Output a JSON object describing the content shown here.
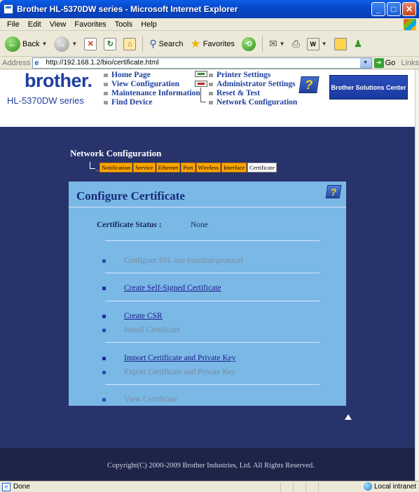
{
  "window": {
    "title": "Brother HL-5370DW series - Microsoft Internet Explorer"
  },
  "menu": [
    "File",
    "Edit",
    "View",
    "Favorites",
    "Tools",
    "Help"
  ],
  "toolbar": {
    "back": "Back",
    "search": "Search",
    "favorites": "Favorites"
  },
  "address": {
    "label": "Address",
    "url": "http://192.168.1.2/bio/certificate.html",
    "go": "Go",
    "links": "Links"
  },
  "header": {
    "logo": "brother.",
    "model": "HL-5370DW series",
    "nav_left": [
      "Home Page",
      "View Configuration",
      "Maintenance Information",
      "Find Device"
    ],
    "nav_right": [
      "Printer Settings",
      "Administrator Settings",
      "Reset & Test",
      "Network Configuration"
    ],
    "solutions": "Brother Solutions Center"
  },
  "section": {
    "title": "Network Configuration",
    "tabs": [
      "Notification",
      "Service",
      "Ethernet",
      "Port",
      "Wireless",
      "Interface",
      "Certificate"
    ],
    "active_tab": "Certificate"
  },
  "panel": {
    "title": "Configure Certificate",
    "status_label": "Certificate Status :",
    "status_value": "None",
    "options": [
      {
        "label": "Configure SSL use function/protocol",
        "enabled": false
      },
      {
        "label": "Create Self-Signed Certificate",
        "enabled": true
      },
      {
        "label": "Create CSR",
        "enabled": true
      },
      {
        "label": "Install Certificate",
        "enabled": false
      },
      {
        "label": "Import Certificate and Private Key",
        "enabled": true
      },
      {
        "label": "Export Certificate and Private Key",
        "enabled": false
      },
      {
        "label": "View Certificate",
        "enabled": false
      }
    ]
  },
  "footer": {
    "copyright": "Copyright(C) 2000-2009 Brother Industries, Ltd. All Rights Reserved."
  },
  "statusbar": {
    "status": "Done",
    "zone": "Local intranet"
  }
}
